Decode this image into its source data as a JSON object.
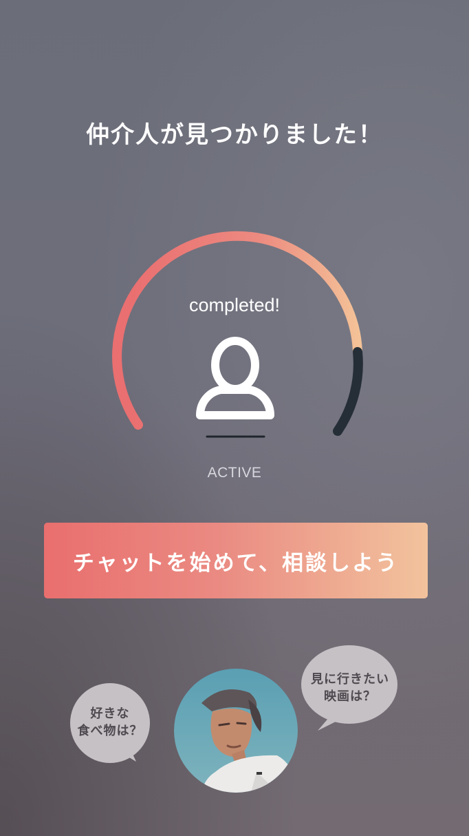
{
  "header": {
    "title": "仲介人が見つかりました！"
  },
  "matching": {
    "status_text": "completed!",
    "indicator_label": "ACTIVE",
    "progress_percent": 80,
    "colors": {
      "arc_start": "#ea6f70",
      "arc_end": "#f4c398",
      "arc_remaining": "#252e36"
    }
  },
  "cta": {
    "label": "チャットを始めて、相談しよう"
  },
  "bubbles": {
    "left_line1": "好きな",
    "left_line2": "食べ物は？",
    "right_line1": "見に行きたい",
    "right_line2": "映画は？"
  },
  "icons": {
    "user": "user-outline-icon"
  }
}
